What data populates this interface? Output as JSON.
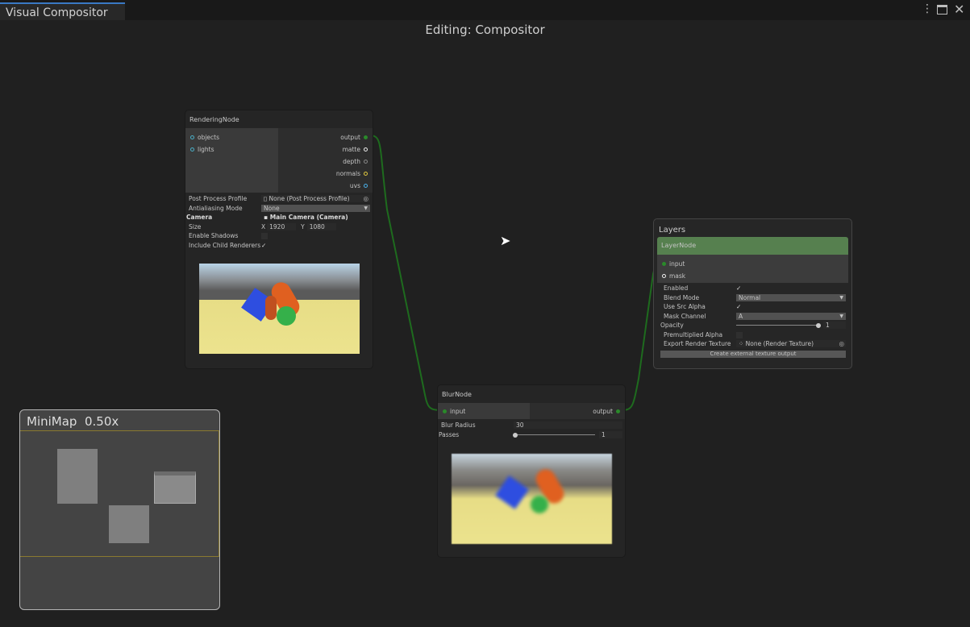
{
  "window": {
    "tab": "Visual Compositor",
    "title": "Editing: Compositor"
  },
  "icons": {
    "menu": "kebab-menu-icon",
    "maximize": "maximize-icon",
    "close": "close-icon"
  },
  "rendering_node": {
    "title": "RenderingNode",
    "inputs": [
      "objects",
      "lights"
    ],
    "outputs": [
      "output",
      "matte",
      "depth",
      "normals",
      "uvs"
    ],
    "props": {
      "post_process_label": "Post Process Profile",
      "post_process_value": "None (Post Process Profile)",
      "aa_label": "Antialiasing Mode",
      "aa_value": "None",
      "camera_label": "Camera",
      "camera_value": "Main Camera (Camera)",
      "size_label": "Size",
      "x_label": "X",
      "x_value": "1920",
      "y_label": "Y",
      "y_value": "1080",
      "shadows_label": "Enable Shadows",
      "child_label": "Include Child Renderers"
    }
  },
  "blur_node": {
    "title": "BlurNode",
    "input": "input",
    "output": "output",
    "radius_label": "Blur Radius",
    "radius_value": "30",
    "passes_label": "Passes",
    "passes_value": "1"
  },
  "layers": {
    "title": "Layers",
    "node_title": "LayerNode",
    "inputs": [
      "input",
      "mask"
    ],
    "enabled_label": "Enabled",
    "blend_label": "Blend Mode",
    "blend_value": "Normal",
    "src_alpha_label": "Use Src Alpha",
    "mask_label": "Mask Channel",
    "mask_value": "A",
    "opacity_label": "Opacity",
    "opacity_value": "1",
    "premult_label": "Premultiplied Alpha",
    "export_label": "Export Render Texture",
    "export_value": "None (Render Texture)",
    "create_button": "Create external texture output"
  },
  "minimap": {
    "label": "MiniMap  0.50x"
  },
  "colors": {
    "wire": "#1e6b1e",
    "layer_header": "#56804f",
    "canvas": "#202020"
  }
}
